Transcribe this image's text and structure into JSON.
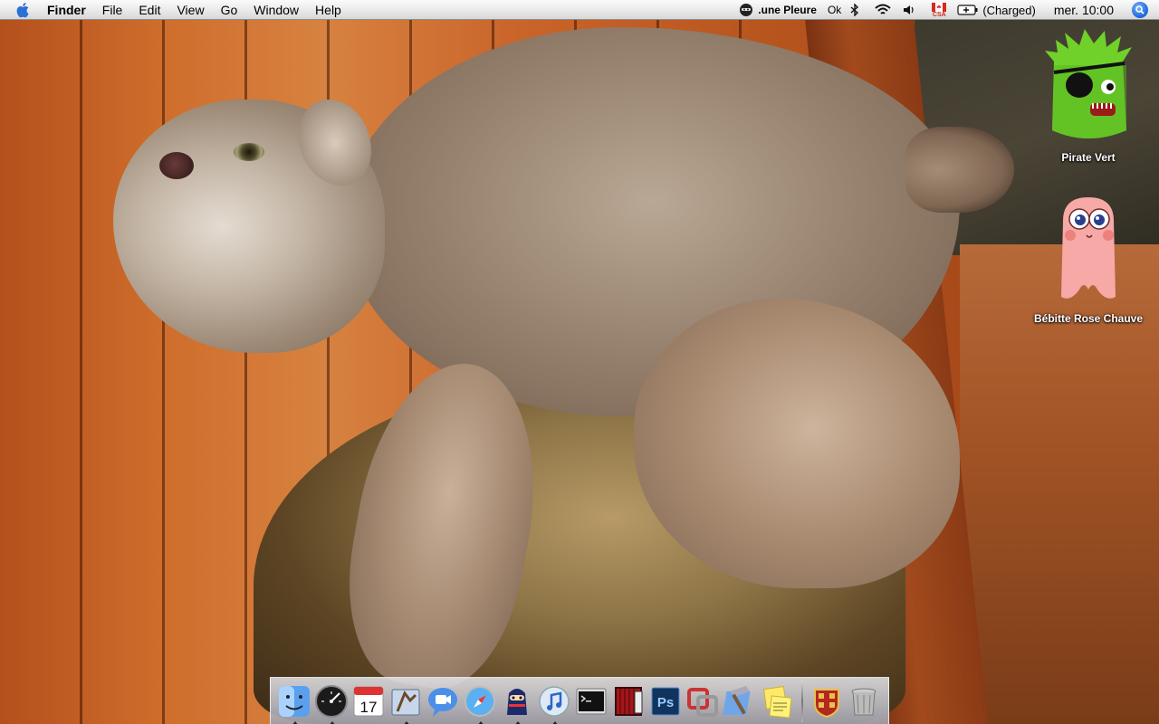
{
  "menubar": {
    "app_name": "Finder",
    "menus": [
      "File",
      "Edit",
      "View",
      "Go",
      "Window",
      "Help"
    ],
    "status": {
      "user_label": ".une Pleure",
      "ok_label": "Ok",
      "battery_label": "(Charged)",
      "clock": "mer. 10:00",
      "flag_label": "CSA"
    }
  },
  "desktop": {
    "icons": [
      {
        "label": "Pirate Vert"
      },
      {
        "label": "Bébitte Rose Chauve"
      }
    ]
  },
  "dock": {
    "items": [
      {
        "name": "finder-icon",
        "running": true
      },
      {
        "name": "dashboard-icon",
        "running": true
      },
      {
        "name": "ical-icon",
        "running": false,
        "date": "17"
      },
      {
        "name": "mail-icon",
        "running": true
      },
      {
        "name": "ichat-icon",
        "running": false
      },
      {
        "name": "safari-icon",
        "running": true
      },
      {
        "name": "ninja-app-icon",
        "running": true
      },
      {
        "name": "itunes-icon",
        "running": true
      },
      {
        "name": "terminal-icon",
        "running": false
      },
      {
        "name": "photo-booth-icon",
        "running": false
      },
      {
        "name": "photoshop-icon",
        "running": false,
        "text": "Ps"
      },
      {
        "name": "parallels-icon",
        "running": false
      },
      {
        "name": "xcode-icon",
        "running": false
      },
      {
        "name": "stickies-icon",
        "running": false
      },
      {
        "name": "coat-of-arms-icon",
        "running": false
      },
      {
        "name": "trash-icon",
        "running": false
      }
    ]
  },
  "colors": {
    "menubar_bg": "#e9e9e9",
    "spotlight": "#1c64d8",
    "pirate_green": "#6fd12a",
    "pink_monster": "#f6a9a6"
  }
}
